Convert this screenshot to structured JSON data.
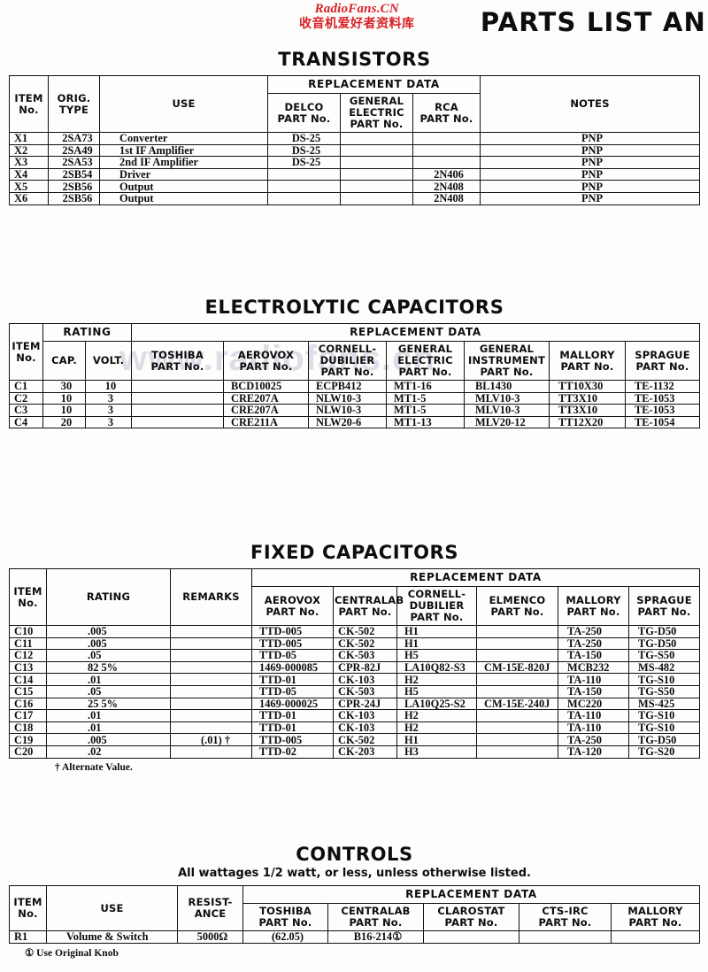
{
  "page": {
    "title": "PARTS LIST AN",
    "watermark_latin": "RadioFans.CN",
    "watermark_cjk": "收音机爱好者资料库",
    "watermark_faint": "www.radiofans.cn"
  },
  "transistors": {
    "title": "TRANSISTORS",
    "group_header": "REPLACEMENT DATA",
    "headers": {
      "item": "ITEM\nNo.",
      "item_l1": "ITEM",
      "item_l2": "No.",
      "orig_l1": "ORIG.",
      "orig_l2": "TYPE",
      "use": "USE",
      "delco_l1": "DELCO",
      "delco_l2": "PART No.",
      "ge_l1": "GENERAL",
      "ge_l2": "ELECTRIC",
      "ge_l3": "PART No.",
      "rca_l1": "RCA",
      "rca_l2": "PART No.",
      "notes": "NOTES"
    },
    "rows": [
      {
        "item": "X1",
        "orig": "2SA73",
        "use": "Converter",
        "delco": "DS-25",
        "ge": "",
        "rca": "",
        "notes": "PNP"
      },
      {
        "item": "X2",
        "orig": "2SA49",
        "use": "1st IF Amplifier",
        "delco": "DS-25",
        "ge": "",
        "rca": "",
        "notes": "PNP"
      },
      {
        "item": "X3",
        "orig": "2SA53",
        "use": "2nd IF Amplifier",
        "delco": "DS-25",
        "ge": "",
        "rca": "",
        "notes": "PNP"
      },
      {
        "item": "X4",
        "orig": "2SB54",
        "use": "Driver",
        "delco": "",
        "ge": "",
        "rca": "2N406",
        "notes": "PNP"
      },
      {
        "item": "X5",
        "orig": "2SB56",
        "use": "Output",
        "delco": "",
        "ge": "",
        "rca": "2N408",
        "notes": "PNP"
      },
      {
        "item": "X6",
        "orig": "2SB56",
        "use": "Output",
        "delco": "",
        "ge": "",
        "rca": "2N408",
        "notes": "PNP"
      }
    ]
  },
  "electrolytics": {
    "title": "ELECTROLYTIC CAPACITORS",
    "group_header": "REPLACEMENT DATA",
    "rating_header": "RATING",
    "headers": {
      "item_l1": "ITEM",
      "item_l2": "No.",
      "cap": "CAP.",
      "volt": "VOLT.",
      "toshiba_l1": "TOSHIBA",
      "toshiba_l2": "PART No.",
      "aerovox_l1": "AEROVOX",
      "aerovox_l2": "PART No.",
      "cd_l1": "CORNELL-",
      "cd_l2": "DUBILIER",
      "cd_l3": "PART No.",
      "ge_l1": "GENERAL",
      "ge_l2": "ELECTRIC",
      "ge_l3": "PART No.",
      "gi_l1": "GENERAL",
      "gi_l2": "INSTRUMENT",
      "gi_l3": "PART No.",
      "mallory_l1": "MALLORY",
      "mallory_l2": "PART No.",
      "sprague_l1": "SPRAGUE",
      "sprague_l2": "PART No."
    },
    "rows": [
      {
        "item": "C1",
        "cap": "30",
        "volt": "10",
        "toshiba": "",
        "aerovox": "BCD10025",
        "cd": "ECPB412",
        "ge": "MT1-16",
        "gi": "BL1430",
        "mallory": "TT10X30",
        "sprague": "TE-1132"
      },
      {
        "item": "C2",
        "cap": "10",
        "volt": "3",
        "toshiba": "",
        "aerovox": "CRE207A",
        "cd": "NLW10-3",
        "ge": "MT1-5",
        "gi": "MLV10-3",
        "mallory": "TT3X10",
        "sprague": "TE-1053"
      },
      {
        "item": "C3",
        "cap": "10",
        "volt": "3",
        "toshiba": "",
        "aerovox": "CRE207A",
        "cd": "NLW10-3",
        "ge": "MT1-5",
        "gi": "MLV10-3",
        "mallory": "TT3X10",
        "sprague": "TE-1053"
      },
      {
        "item": "C4",
        "cap": "20",
        "volt": "3",
        "toshiba": "",
        "aerovox": "CRE211A",
        "cd": "NLW20-6",
        "ge": "MT1-13",
        "gi": "MLV20-12",
        "mallory": "TT12X20",
        "sprague": "TE-1054"
      }
    ]
  },
  "fixed_capacitors": {
    "title": "FIXED CAPACITORS",
    "group_header": "REPLACEMENT DATA",
    "headers": {
      "item_l1": "ITEM",
      "item_l2": "No.",
      "rating": "RATING",
      "remarks": "REMARKS",
      "aerovox_l1": "AEROVOX",
      "aerovox_l2": "PART No.",
      "centralab_l1": "CENTRALAB",
      "centralab_l2": "PART No.",
      "cd_l1": "CORNELL-",
      "cd_l2": "DUBILIER",
      "cd_l3": "PART No.",
      "elmenco_l1": "ELMENCO",
      "elmenco_l2": "PART No.",
      "mallory_l1": "MALLORY",
      "mallory_l2": "PART No.",
      "sprague_l1": "SPRAGUE",
      "sprague_l2": "PART No."
    },
    "rows": [
      {
        "item": "C10",
        "rating": ".005",
        "remarks": "",
        "aerovox": "TTD-005",
        "centralab": "CK-502",
        "cd": "H1",
        "elmenco": "",
        "mallory": "TA-250",
        "sprague": "TG-D50"
      },
      {
        "item": "C11",
        "rating": ".005",
        "remarks": "",
        "aerovox": "TTD-005",
        "centralab": "CK-502",
        "cd": "H1",
        "elmenco": "",
        "mallory": "TA-250",
        "sprague": "TG-D50"
      },
      {
        "item": "C12",
        "rating": ".05",
        "remarks": "",
        "aerovox": "TTD-05",
        "centralab": "CK-503",
        "cd": "H5",
        "elmenco": "",
        "mallory": "TA-150",
        "sprague": "TG-S50"
      },
      {
        "item": "C13",
        "rating": "82 5%",
        "remarks": "",
        "aerovox": "1469-000085",
        "centralab": "CPR-82J",
        "cd": "LA10Q82-S3",
        "elmenco": "CM-15E-820J",
        "mallory": "MCB232",
        "sprague": "MS-482"
      },
      {
        "item": "C14",
        "rating": ".01",
        "remarks": "",
        "aerovox": "TTD-01",
        "centralab": "CK-103",
        "cd": "H2",
        "elmenco": "",
        "mallory": "TA-110",
        "sprague": "TG-S10"
      },
      {
        "item": "C15",
        "rating": ".05",
        "remarks": "",
        "aerovox": "TTD-05",
        "centralab": "CK-503",
        "cd": "H5",
        "elmenco": "",
        "mallory": "TA-150",
        "sprague": "TG-S50"
      },
      {
        "item": "C16",
        "rating": "25 5%",
        "remarks": "",
        "aerovox": "1469-000025",
        "centralab": "CPR-24J",
        "cd": "LA10Q25-S2",
        "elmenco": "CM-15E-240J",
        "mallory": "MC220",
        "sprague": "MS-425"
      },
      {
        "item": "C17",
        "rating": ".01",
        "remarks": "",
        "aerovox": "TTD-01",
        "centralab": "CK-103",
        "cd": "H2",
        "elmenco": "",
        "mallory": "TA-110",
        "sprague": "TG-S10"
      },
      {
        "item": "C18",
        "rating": ".01",
        "remarks": "",
        "aerovox": "TTD-01",
        "centralab": "CK-103",
        "cd": "H2",
        "elmenco": "",
        "mallory": "TA-110",
        "sprague": "TG-S10"
      },
      {
        "item": "C19",
        "rating": ".005",
        "remarks": "(.01) †",
        "aerovox": "TTD-005",
        "centralab": "CK-502",
        "cd": "H1",
        "elmenco": "",
        "mallory": "TA-250",
        "sprague": "TG-D50"
      },
      {
        "item": "C20",
        "rating": ".02",
        "remarks": "",
        "aerovox": "TTD-02",
        "centralab": "CK-203",
        "cd": "H3",
        "elmenco": "",
        "mallory": "TA-120",
        "sprague": "TG-S20"
      }
    ],
    "footnote": "† Alternate Value."
  },
  "controls": {
    "title": "CONTROLS",
    "subtitle": "All wattages 1/2 watt, or less, unless otherwise listed.",
    "group_header": "REPLACEMENT DATA",
    "headers": {
      "item_l1": "ITEM",
      "item_l2": "No.",
      "use": "USE",
      "resist_l1": "RESIST-",
      "resist_l2": "ANCE",
      "toshiba_l1": "TOSHIBA",
      "toshiba_l2": "PART No.",
      "centralab_l1": "CENTRALAB",
      "centralab_l2": "PART No.",
      "clarostat_l1": "CLAROSTAT",
      "clarostat_l2": "PART No.",
      "ctsirc_l1": "CTS-IRC",
      "ctsirc_l2": "PART No.",
      "mallory_l1": "MALLORY",
      "mallory_l2": "PART No."
    },
    "rows": [
      {
        "item": "R1",
        "use": "Volume & Switch",
        "resistance": "5000Ω",
        "toshiba": "(62.05)",
        "centralab": "B16-214①",
        "clarostat": "",
        "ctsirc": "",
        "mallory": ""
      }
    ],
    "footnote": "① Use Original Knob"
  }
}
